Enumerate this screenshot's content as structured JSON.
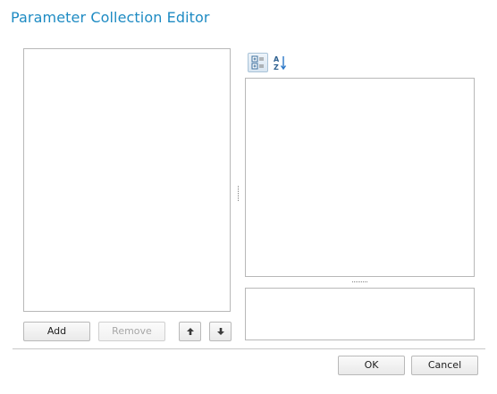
{
  "dialog": {
    "title": "Parameter Collection Editor"
  },
  "members_panel": {
    "add_label": "Add",
    "remove_label": "Remove",
    "move_up_icon": "arrow-up-icon",
    "move_down_icon": "arrow-down-icon"
  },
  "property_panel": {
    "toolbar": [
      {
        "icon": "categorized-icon",
        "active": true
      },
      {
        "icon": "sort-alphabetical-icon",
        "active": false
      }
    ]
  },
  "footer": {
    "ok_label": "OK",
    "cancel_label": "Cancel"
  },
  "colors": {
    "title": "#1e8bc3",
    "border": "#b8b8b8"
  }
}
